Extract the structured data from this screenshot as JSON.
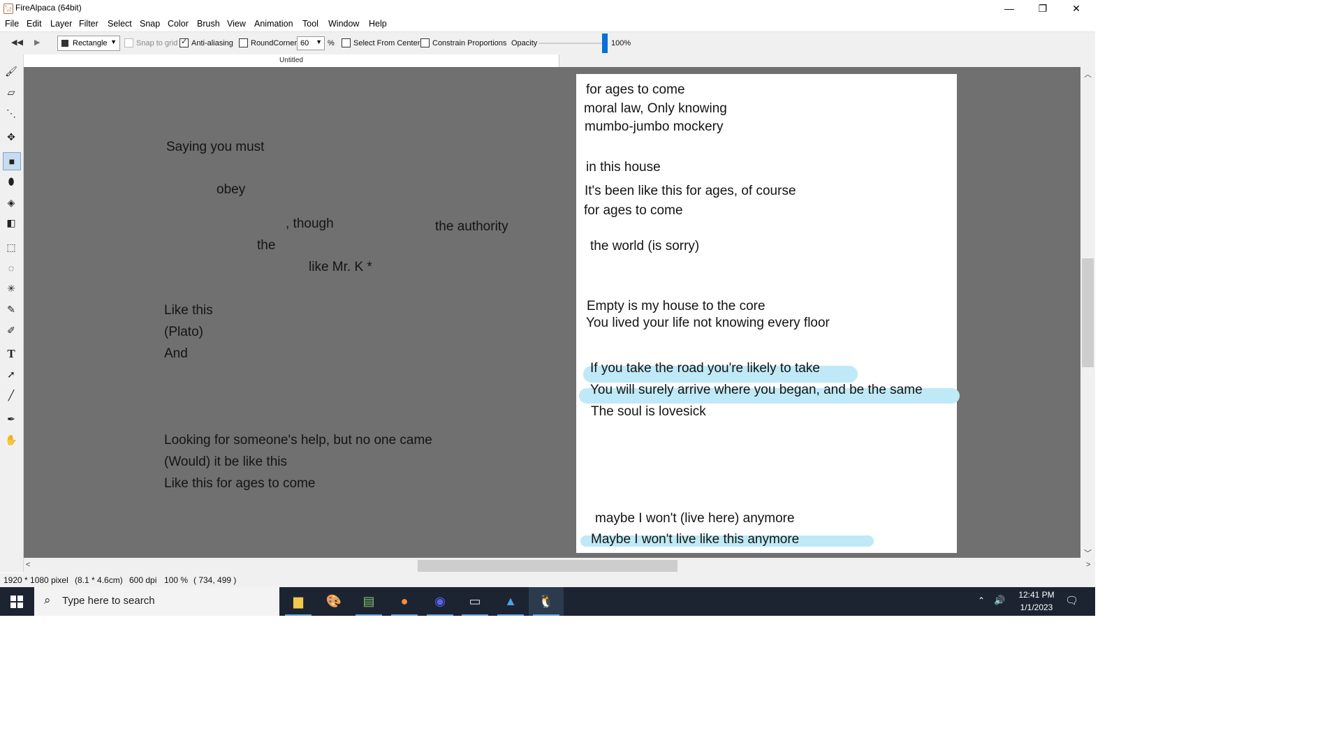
{
  "window": {
    "title": "FireAlpaca (64bit)",
    "min": "—",
    "max": "❐",
    "close": "✕"
  },
  "menu": [
    "File",
    "Edit",
    "Layer",
    "Filter",
    "Select",
    "Snap",
    "Color",
    "Brush",
    "View",
    "Animation",
    "Tool",
    "Window",
    "Help"
  ],
  "toolbar": {
    "shape": "Rectangle",
    "snap_to_grid": "Snap to grid",
    "anti_aliasing": "Anti-aliasing",
    "round_corner": "RoundCorner",
    "round_value": "60",
    "percent": "%",
    "select_from_center": "Select From Center",
    "constrain_proportions": "Constrain Proportions",
    "opacity_label": "Opacity",
    "opacity_value": "100%",
    "opacity_level": 1.0,
    "snap_checked": false,
    "anti_aliasing_checked": true,
    "round_corner_checked": false,
    "select_from_center_checked": false,
    "constrain_proportions_checked": false
  },
  "tab": {
    "title": "Untitled"
  },
  "canvas_text": {
    "saying": "Saying you must",
    "obey": "obey",
    "though": ", though",
    "authority": "the authority",
    "the": "the",
    "mrk": "like Mr. K *",
    "likethis": "Like this",
    "plato": "(Plato)",
    "and": "And",
    "help": "Looking for someone's help, but no one came",
    "would": "(Would) it be like this",
    "ages": "Like this for ages to come"
  },
  "page_text": {
    "l1": "for ages to come",
    "l2": "moral law,  Only knowing",
    "l3": "mumbo-jumbo mockery",
    "l4": "in this house",
    "l5": "It's been like this for ages, of course",
    "l6": "for ages to come",
    "l7": "the world (is sorry)",
    "l8": "Empty is my house to the core",
    "l9": "You lived your life  not knowing every floor",
    "l10": "If you take the road you're likely to take",
    "l11": "You will surely arrive where you began, and be the same",
    "l12": "The soul is lovesick",
    "l13": "maybe I won't (live here) anymore",
    "l14": "Maybe I won't live like this anymore"
  },
  "highlight_color": "#bfe9f6",
  "status": {
    "size": "1920 * 1080 pixel",
    "cm": "(8.1 * 4.6cm)",
    "dpi": "600 dpi",
    "zoom": "100 %",
    "coords": "( 734, 499 )"
  },
  "taskbar": {
    "search_placeholder": "Type here to search",
    "time": "12:41 PM",
    "date": "1/1/2023",
    "apps": [
      "file-explorer",
      "paint-app",
      "notepad-app",
      "firefox",
      "discord",
      "terminal",
      "photos",
      "firealpaca"
    ]
  }
}
